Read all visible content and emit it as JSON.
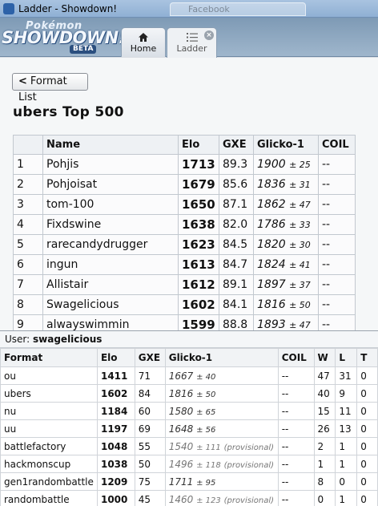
{
  "window": {
    "title": "Ladder - Showdown!",
    "ghost_tab": "Facebook"
  },
  "logo": {
    "line1": "Pokémon",
    "line2": "SHOWDOWN!",
    "badge": "BETA"
  },
  "tabs": {
    "home": "Home",
    "ladder": "Ladder",
    "close_glyph": "×"
  },
  "main": {
    "back_button": "Format List",
    "back_glyph": "<",
    "title": "ubers Top 500"
  },
  "ladder": {
    "headers": [
      "",
      "Name",
      "Elo",
      "GXE",
      "Glicko-1",
      "COIL"
    ],
    "rows": [
      {
        "rank": "1",
        "name": "Pohjis",
        "elo": "1713",
        "gxe": "89.3",
        "glicko": "1900",
        "dev": "± 25",
        "coil": "--"
      },
      {
        "rank": "2",
        "name": "Pohjoisat",
        "elo": "1679",
        "gxe": "85.6",
        "glicko": "1836",
        "dev": "± 31",
        "coil": "--"
      },
      {
        "rank": "3",
        "name": "tom-100",
        "elo": "1650",
        "gxe": "87.1",
        "glicko": "1862",
        "dev": "± 47",
        "coil": "--"
      },
      {
        "rank": "4",
        "name": "Fixdswine",
        "elo": "1638",
        "gxe": "82.0",
        "glicko": "1786",
        "dev": "± 33",
        "coil": "--"
      },
      {
        "rank": "5",
        "name": "rarecandydrugger",
        "elo": "1623",
        "gxe": "84.5",
        "glicko": "1820",
        "dev": "± 30",
        "coil": "--"
      },
      {
        "rank": "6",
        "name": "ingun",
        "elo": "1613",
        "gxe": "84.7",
        "glicko": "1824",
        "dev": "± 41",
        "coil": "--"
      },
      {
        "rank": "7",
        "name": "Allistair",
        "elo": "1612",
        "gxe": "89.1",
        "glicko": "1897",
        "dev": "± 37",
        "coil": "--"
      },
      {
        "rank": "8",
        "name": "Swagelicious",
        "elo": "1602",
        "gxe": "84.1",
        "glicko": "1816",
        "dev": "± 50",
        "coil": "--"
      },
      {
        "rank": "9",
        "name": "alwayswimmin",
        "elo": "1599",
        "gxe": "88.8",
        "glicko": "1893",
        "dev": "± 47",
        "coil": "--"
      }
    ]
  },
  "popup": {
    "user_label": "User:",
    "username": "swagelicious",
    "headers": [
      "Format",
      "Elo",
      "GXE",
      "Glicko-1",
      "COIL",
      "W",
      "L",
      "T"
    ],
    "rows": [
      {
        "format": "ou",
        "elo": "1411",
        "gxe": "71",
        "glicko": "1667",
        "dev": "± 40",
        "prov": "",
        "coil": "--",
        "w": "47",
        "l": "31",
        "t": "0"
      },
      {
        "format": "ubers",
        "elo": "1602",
        "gxe": "84",
        "glicko": "1816",
        "dev": "± 50",
        "prov": "",
        "coil": "--",
        "w": "40",
        "l": "9",
        "t": "0"
      },
      {
        "format": "nu",
        "elo": "1184",
        "gxe": "60",
        "glicko": "1580",
        "dev": "± 65",
        "prov": "",
        "coil": "--",
        "w": "15",
        "l": "11",
        "t": "0"
      },
      {
        "format": "uu",
        "elo": "1197",
        "gxe": "69",
        "glicko": "1648",
        "dev": "± 56",
        "prov": "",
        "coil": "--",
        "w": "26",
        "l": "13",
        "t": "0"
      },
      {
        "format": "battlefactory",
        "elo": "1048",
        "gxe": "55",
        "glicko": "1540",
        "dev": "± 111",
        "prov": "(provisional)",
        "coil": "--",
        "w": "2",
        "l": "1",
        "t": "0"
      },
      {
        "format": "hackmonscup",
        "elo": "1038",
        "gxe": "50",
        "glicko": "1496",
        "dev": "± 118",
        "prov": "(provisional)",
        "coil": "--",
        "w": "1",
        "l": "1",
        "t": "0"
      },
      {
        "format": "gen1randombattle",
        "elo": "1209",
        "gxe": "75",
        "glicko": "1711",
        "dev": "± 95",
        "prov": "",
        "coil": "--",
        "w": "8",
        "l": "0",
        "t": "0"
      },
      {
        "format": "randombattle",
        "elo": "1000",
        "gxe": "45",
        "glicko": "1460",
        "dev": "± 123",
        "prov": "(provisional)",
        "coil": "--",
        "w": "0",
        "l": "1",
        "t": "0"
      }
    ]
  }
}
